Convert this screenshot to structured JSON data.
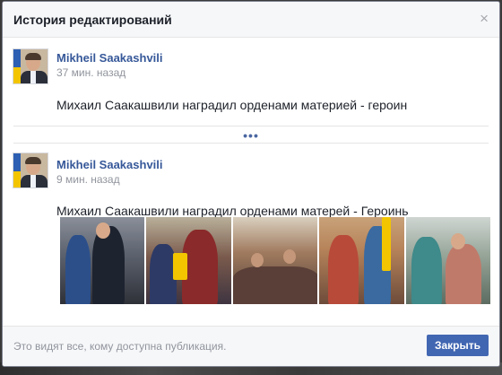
{
  "dialog": {
    "title": "История редактирований",
    "close_symbol": "×"
  },
  "revisions": [
    {
      "author": "Mikheil Saakashvili",
      "time": "37 мин. назад",
      "text": "Михаил Саакашвили наградил орденами материей - героин"
    },
    {
      "author": "Mikheil Saakashvili",
      "time": "9 мин. назад",
      "text": "Михаил Саакашвили наградил орденами матерей - Героинь",
      "photo_count": 5
    }
  ],
  "more_indicator": "•••",
  "footer": {
    "note": "Это видят все, кому доступна публикация.",
    "close_button": "Закрыть"
  },
  "colors": {
    "link": "#365899",
    "button": "#4267b2",
    "muted": "#90949c"
  }
}
